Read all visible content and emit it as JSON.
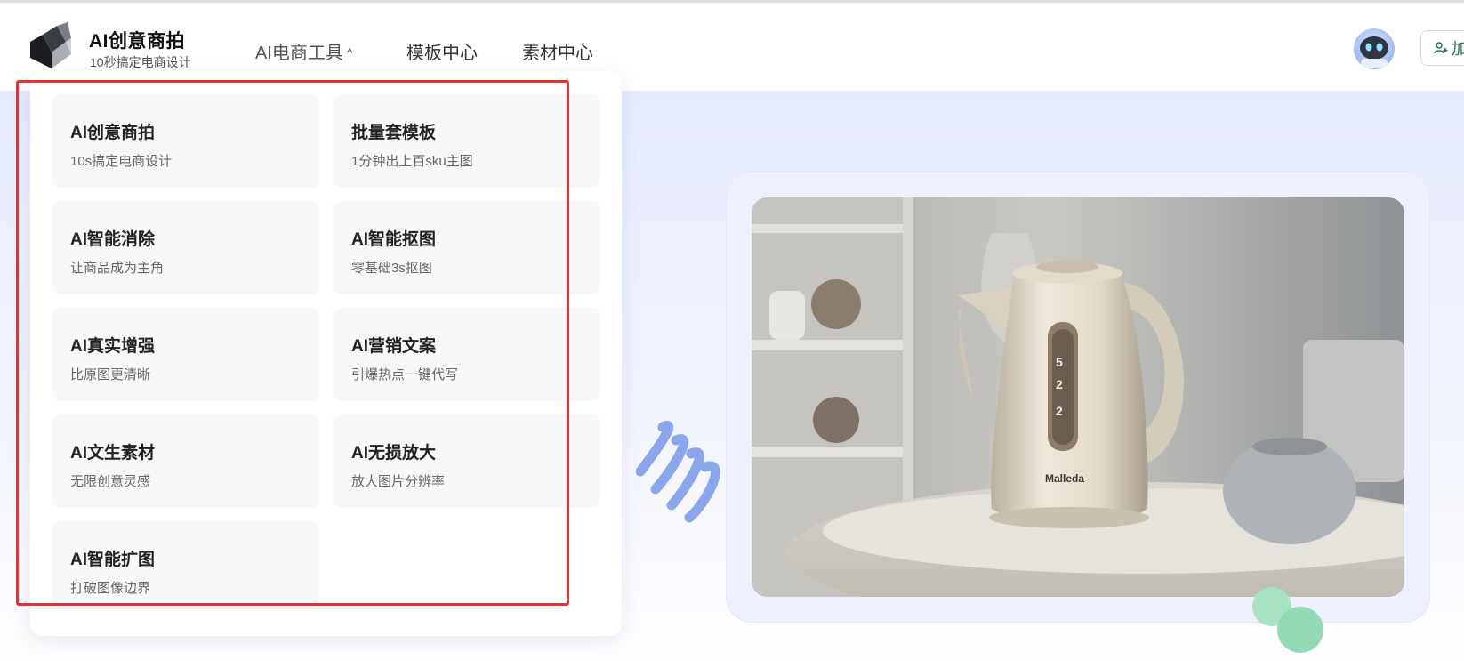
{
  "brand": {
    "title": "AI创意商拍",
    "subtitle": "10秒搞定电商设计"
  },
  "nav": {
    "tools_label": "AI电商工具",
    "tools_chevron": "^",
    "templates_label": "模板中心",
    "materials_label": "素材中心"
  },
  "header_right": {
    "avatar_icon": "robot-avatar-icon",
    "join_label": "加"
  },
  "dropdown": {
    "items": [
      {
        "title": "AI创意商拍",
        "sub": "10s搞定电商设计"
      },
      {
        "title": "批量套模板",
        "sub": "1分钟出上百sku主图"
      },
      {
        "title": "AI智能消除",
        "sub": "让商品成为主角"
      },
      {
        "title": "AI智能抠图",
        "sub": "零基础3s抠图"
      },
      {
        "title": "AI真实增强",
        "sub": "比原图更清晰"
      },
      {
        "title": "AI营销文案",
        "sub": "引爆热点一键代写"
      },
      {
        "title": "AI文生素材",
        "sub": "无限创意灵感"
      },
      {
        "title": "AI无损放大",
        "sub": "放大图片分辨率"
      },
      {
        "title": "AI智能扩图",
        "sub": "打破图像边界"
      }
    ]
  },
  "hero": {
    "product_brand": "Malleda",
    "kettle_display": [
      "5",
      "2",
      "2"
    ]
  },
  "colors": {
    "highlight_border": "#e5322d",
    "hero_bg": "#e6ebfd",
    "card_bg": "#f7f8fa",
    "accent_green": "#1f7a53"
  }
}
